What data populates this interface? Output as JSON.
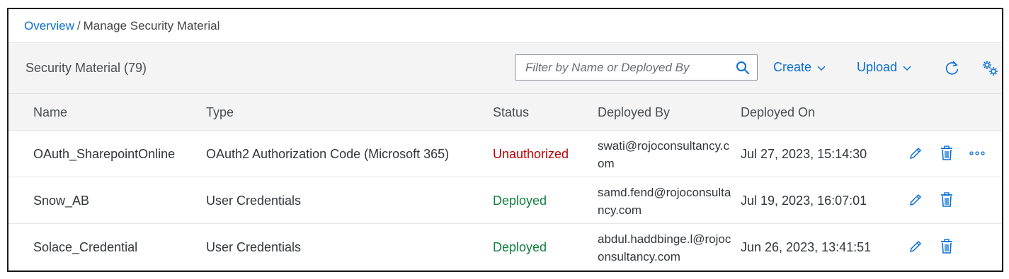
{
  "breadcrumb": {
    "link": "Overview",
    "separator": "/",
    "current": "Manage Security Material"
  },
  "toolbar": {
    "title": "Security Material (79)",
    "search_placeholder": "Filter by Name or Deployed By",
    "create_label": "Create",
    "upload_label": "Upload",
    "icons": {
      "search": "search-icon",
      "dropdown": "chevron-down-icon",
      "refresh": "refresh-icon",
      "settings": "gear-icon"
    }
  },
  "table": {
    "columns": [
      "Name",
      "Type",
      "Status",
      "Deployed By",
      "Deployed On"
    ],
    "rows": [
      {
        "name": "OAuth_SharepointOnline",
        "type": "OAuth2 Authorization Code (Microsoft 365)",
        "status": "Unauthorized",
        "deployed_by": "swati@rojoconsultancy.com",
        "deployed_on": "Jul 27, 2023, 15:14:30"
      },
      {
        "name": "Snow_AB",
        "type": "User Credentials",
        "status": "Deployed",
        "deployed_by": "samd.fend@rojoconsultancy.com",
        "deployed_on": "Jul 19, 2023, 16:07:01"
      },
      {
        "name": "Solace_Credential",
        "type": "User Credentials",
        "status": "Deployed",
        "deployed_by": "abdul.haddbinge.l@rojoconsultancy.com",
        "deployed_on": "Jun 26, 2023, 13:41:51"
      }
    ],
    "row_icons": [
      "edit-icon",
      "delete-icon",
      "more-icon"
    ]
  },
  "colors": {
    "link": "#0a6ed1",
    "unauthorized": "#bb0000",
    "deployed": "#107e3e",
    "header_bg": "#f4f4f4"
  }
}
